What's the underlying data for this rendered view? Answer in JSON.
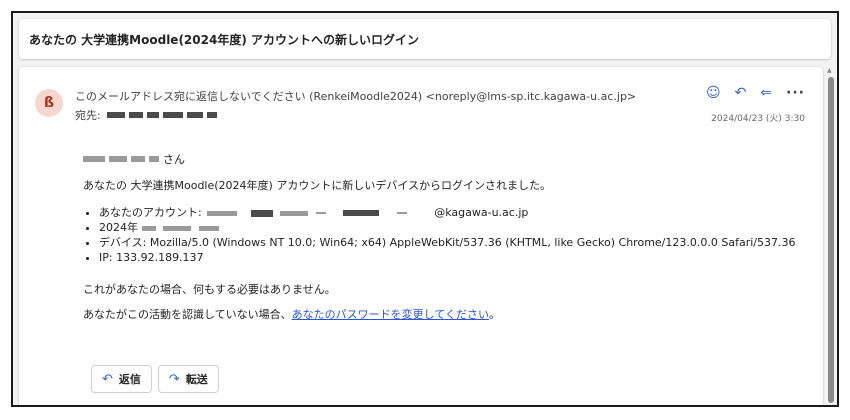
{
  "subject": "あなたの 大学連携Moodle(2024年度) アカウントへの新しいログイン",
  "sender": {
    "avatar_initial": "ß",
    "from_text": "このメールアドレス宛に返信しないでください (RenkeiMoodle2024) <noreply@lms-sp.itc.kagawa-u.ac.jp>",
    "to_label": "宛先:",
    "date": "2024/04/23 (火) 3:30"
  },
  "header_actions": {
    "react_icon": "smile-icon",
    "reply_icon": "reply-icon",
    "reply_all_icon": "reply-all-icon",
    "more_icon": "more-icon"
  },
  "body": {
    "greeting_suffix": "さん",
    "intro": "あなたの 大学連携Moodle(2024年度) アカウントに新しいデバイスからログインされました。",
    "account_label": "あなたのアカウント:",
    "account_domain": "@kagawa-u.ac.jp",
    "date_prefix": "2024年",
    "device": "デバイス: Mozilla/5.0 (Windows NT 10.0; Win64; x64) AppleWebKit/537.36 (KHTML, like Gecko) Chrome/123.0.0.0 Safari/537.36",
    "ip": "IP: 133.92.189.137",
    "notice": "これがあなたの場合、何もする必要はありません。",
    "warn_prefix": "あなたがこの活動を認識していない場合、",
    "warn_link": "あなたのパスワードを変更してください",
    "warn_suffix": "。"
  },
  "reply_buttons": {
    "reply_label": "返信",
    "forward_label": "転送"
  },
  "colors": {
    "accent": "#3a66c8",
    "link": "#2a55d6",
    "avatar_bg": "#f6d6cf",
    "avatar_fg": "#a3351f"
  }
}
